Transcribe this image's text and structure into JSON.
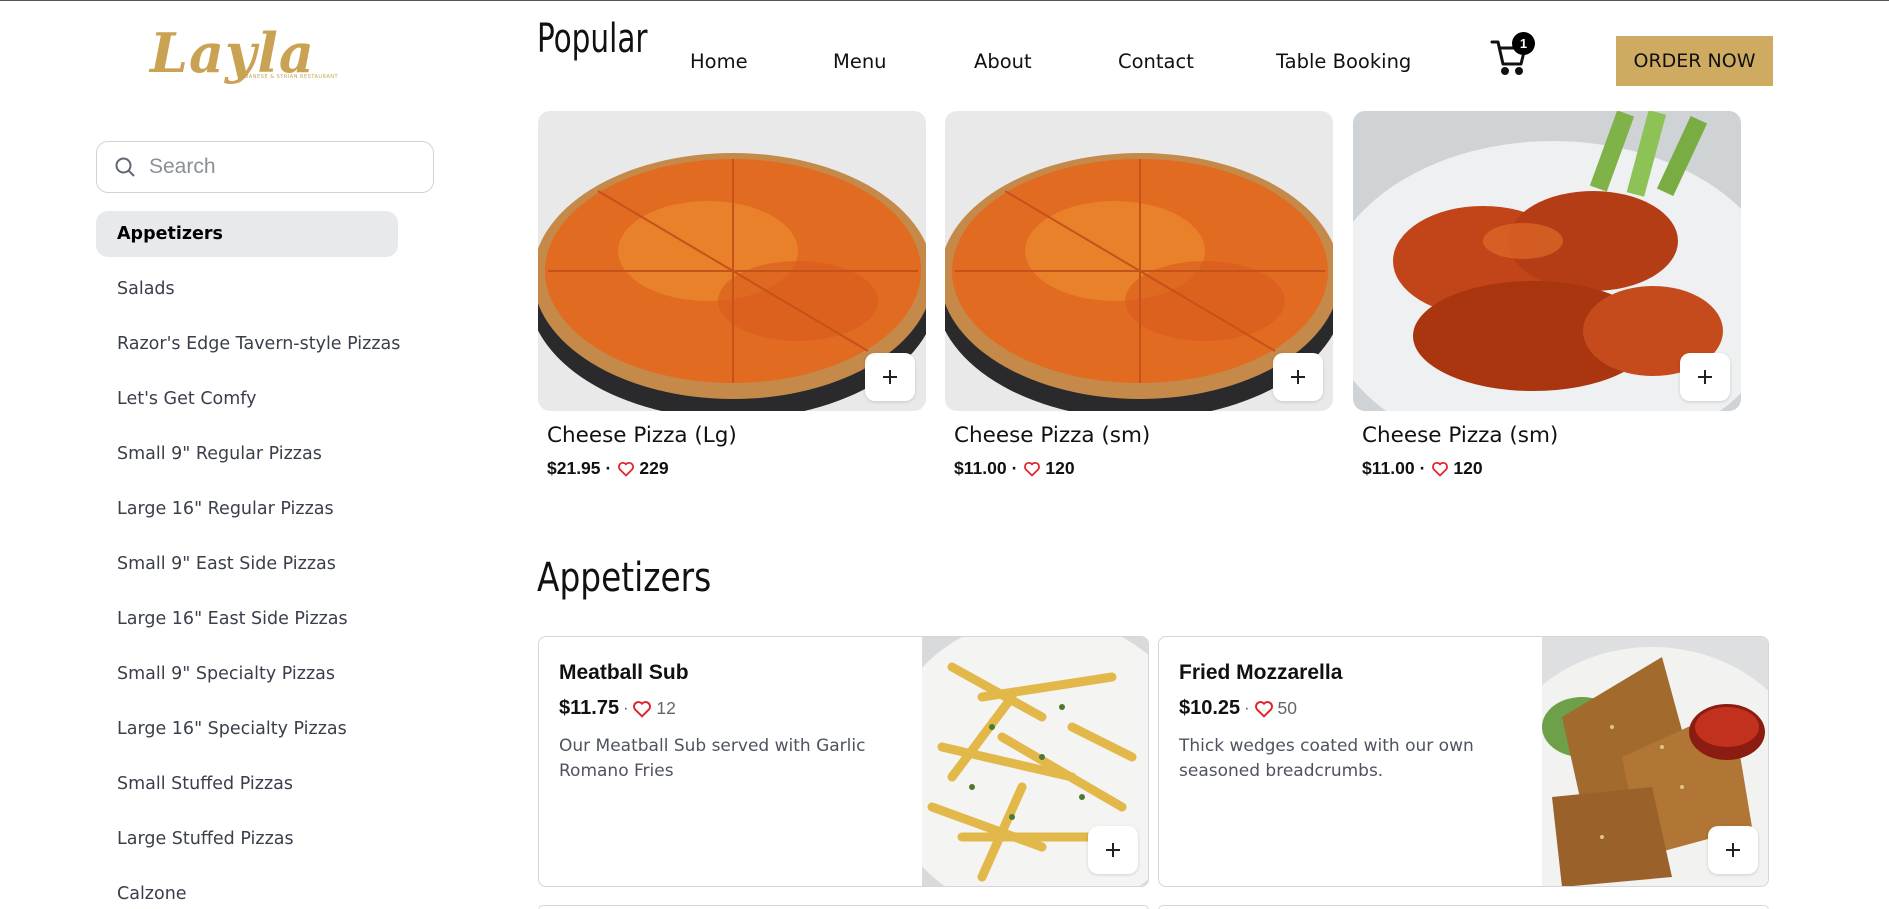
{
  "brand": {
    "logo_text": "Layla",
    "logo_subtext": "LEBANESE & SYRIAN RESTAURANT",
    "color": "#c9a253"
  },
  "header": {
    "section_title": "Popular",
    "nav": [
      "Home",
      "Menu",
      "About",
      "Contact",
      "Table Booking"
    ],
    "cart_count": "1",
    "order_button": "ORDER NOW",
    "order_button_color": "#cfab62"
  },
  "sidebar": {
    "search_placeholder": "Search",
    "categories": [
      "Appetizers",
      "Salads",
      "Razor's Edge Tavern-style Pizzas",
      "Let's Get Comfy",
      "Small 9\" Regular Pizzas",
      "Large 16\" Regular Pizzas",
      "Small 9\" East Side Pizzas",
      "Large 16\" East Side Pizzas",
      "Small 9\" Specialty Pizzas",
      "Large 16\" Specialty Pizzas",
      "Small Stuffed Pizzas",
      "Large Stuffed Pizzas",
      "Calzone"
    ],
    "active_category": "Appetizers"
  },
  "popular": [
    {
      "name": "Cheese Pizza (Lg)",
      "price": "$21.95",
      "likes": "229",
      "image": "pizza"
    },
    {
      "name": "Cheese Pizza (sm)",
      "price": "$11.00",
      "likes": "120",
      "image": "pizza"
    },
    {
      "name": "Cheese Pizza (sm)",
      "price": "$11.00",
      "likes": "120",
      "image": "wings"
    }
  ],
  "appetizers": {
    "title": "Appetizers",
    "items": [
      {
        "name": "Meatball Sub",
        "price": "$11.75",
        "likes": "12",
        "description": "Our Meatball Sub served with Garlic Romano Fries",
        "image": "fries"
      },
      {
        "name": "Fried Mozzarella",
        "price": "$10.25",
        "likes": "50",
        "description": "Thick wedges coated with our own seasoned breadcrumbs.",
        "image": "mozzarella"
      }
    ]
  },
  "separator": "·",
  "icons": {
    "search": "search-icon",
    "cart": "cart-icon",
    "heart": "heart-icon",
    "add": "plus-icon"
  },
  "colors": {
    "heart": "#e0242c",
    "active_category_bg": "#e8e9ec"
  }
}
